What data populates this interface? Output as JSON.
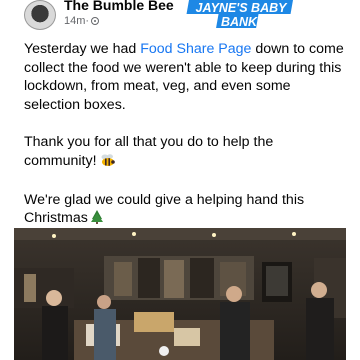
{
  "post": {
    "author": "The Bumble Bee",
    "time": "14m",
    "separator": "·",
    "logo_line1": "JAYNE'S BABY",
    "logo_line2": "BANK",
    "paragraph1_before": "Yesterday we had ",
    "paragraph1_link": "Food Share Page",
    "paragraph1_after": " down to come collect the food we weren't able to keep during this lockdown, from meat, veg, and even some selection boxes.",
    "paragraph2": "Thank you for all that you do to help the community!",
    "paragraph3": "We're glad we could give a helping hand this Christmas"
  },
  "icons": {
    "privacy": "globe-icon",
    "bee": "bee-emoji-icon",
    "tree": "christmas-tree-emoji-icon"
  },
  "colors": {
    "link": "#1877f2",
    "logo_blue": "#1e88e5",
    "meta_grey": "#65676b"
  }
}
